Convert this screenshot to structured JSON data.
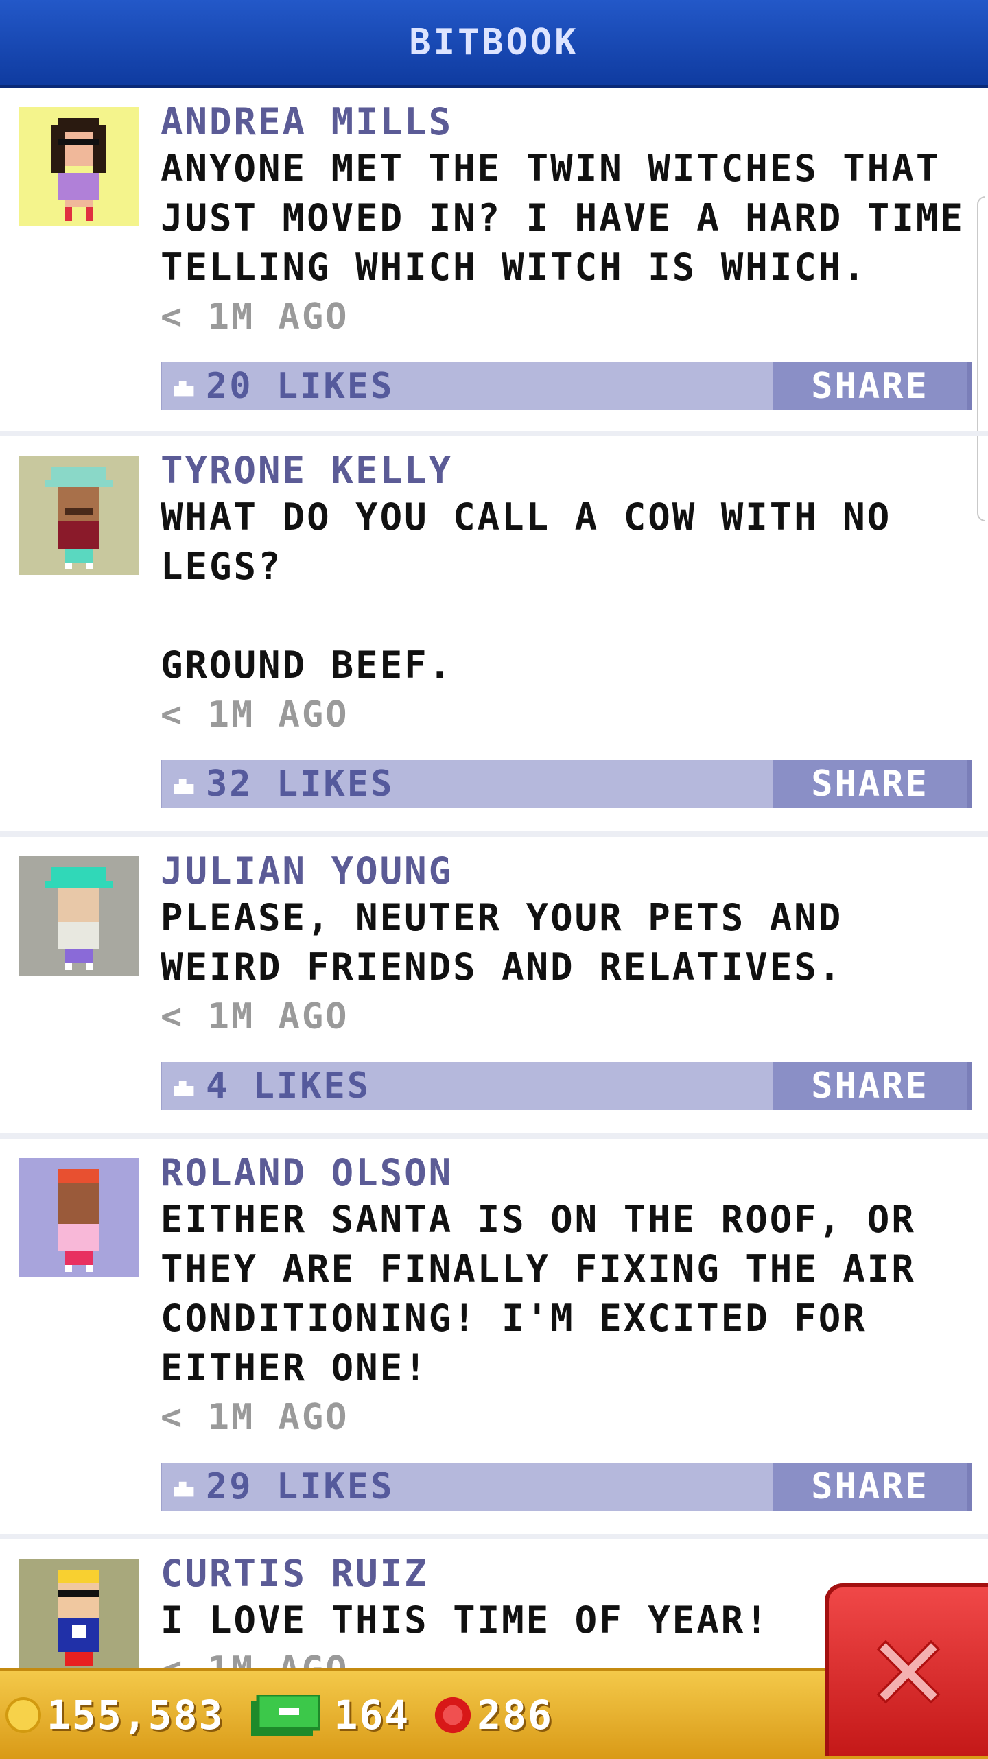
{
  "header": {
    "title": "BITBOOK"
  },
  "posts": [
    {
      "name": "ANDREA MILLS",
      "text": "ANYONE MET THE TWIN WITCHES THAT JUST MOVED IN? I HAVE A HARD TIME TELLING WHICH WITCH IS WHICH.",
      "time": "< 1M AGO",
      "likes": "20 LIKES",
      "share": "SHARE",
      "avatar_bg": "#f4f48c"
    },
    {
      "name": "TYRONE KELLY",
      "text": "WHAT DO YOU CALL A COW WITH NO LEGS?\n\nGROUND BEEF.",
      "time": "< 1M AGO",
      "likes": "32 LIKES",
      "share": "SHARE",
      "avatar_bg": "#c8c89e"
    },
    {
      "name": "JULIAN YOUNG",
      "text": "PLEASE, NEUTER YOUR PETS AND WEIRD FRIENDS AND RELATIVES.",
      "time": "< 1M AGO",
      "likes": "4 LIKES",
      "share": "SHARE",
      "avatar_bg": "#a8a8a0"
    },
    {
      "name": "ROLAND OLSON",
      "text": "EITHER SANTA IS ON THE ROOF, OR THEY ARE FINALLY FIXING THE AIR CONDITIONING! I'M EXCITED FOR EITHER ONE!",
      "time": "< 1M AGO",
      "likes": "29 LIKES",
      "share": "SHARE",
      "avatar_bg": "#a8a4dc"
    },
    {
      "name": "CURTIS RUIZ",
      "text": "I LOVE THIS TIME OF YEAR!",
      "time": "< 1M AGO",
      "avatar_bg": "#a8a87c"
    }
  ],
  "status": {
    "coins": "155,583",
    "cash": "164",
    "gems": "286"
  },
  "icons": {
    "like": "thumbs-up-icon",
    "coin": "coin-icon",
    "cash": "cash-icon",
    "gem": "gem-icon",
    "close": "close-icon"
  },
  "colors": {
    "header": "#1a4ab6",
    "name": "#5b5b96",
    "likebar": "#b5b8dc",
    "share": "#8a8fc6",
    "bottombar": "#e9b42c",
    "close": "#e02828"
  }
}
